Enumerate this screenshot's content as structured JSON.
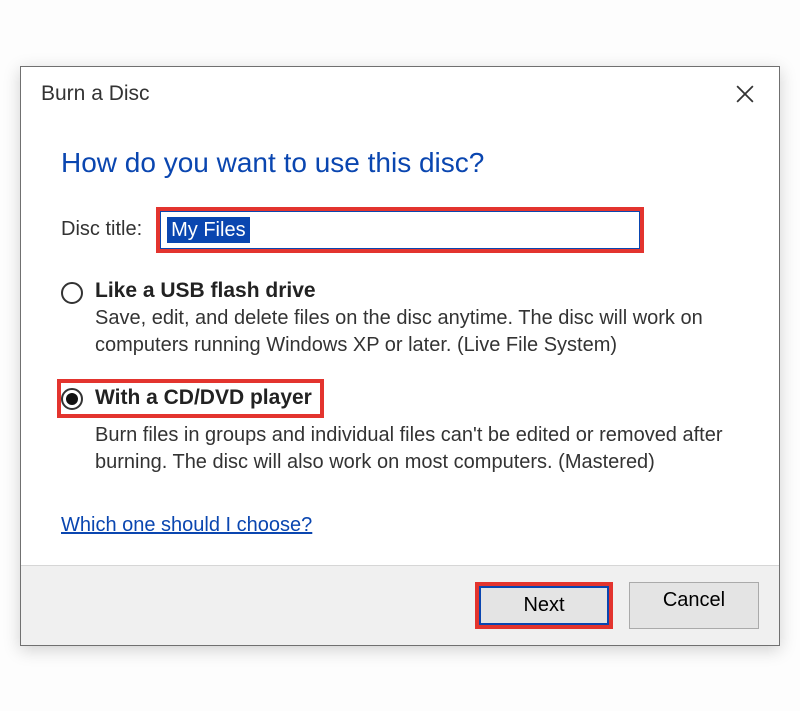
{
  "window": {
    "title": "Burn a Disc"
  },
  "heading": "How do you want to use this disc?",
  "disc_title": {
    "label": "Disc title:",
    "value": "My Files"
  },
  "options": {
    "usb": {
      "title": "Like a USB flash drive",
      "desc": "Save, edit, and delete files on the disc anytime. The disc will work on computers running Windows XP or later. (Live File System)",
      "selected": false
    },
    "cddvd": {
      "title": "With a CD/DVD player",
      "desc": "Burn files in groups and individual files can't be edited or removed after burning. The disc will also work on most computers. (Mastered)",
      "selected": true
    }
  },
  "help_link": "Which one should I choose?",
  "buttons": {
    "next": "Next",
    "cancel": "Cancel"
  }
}
